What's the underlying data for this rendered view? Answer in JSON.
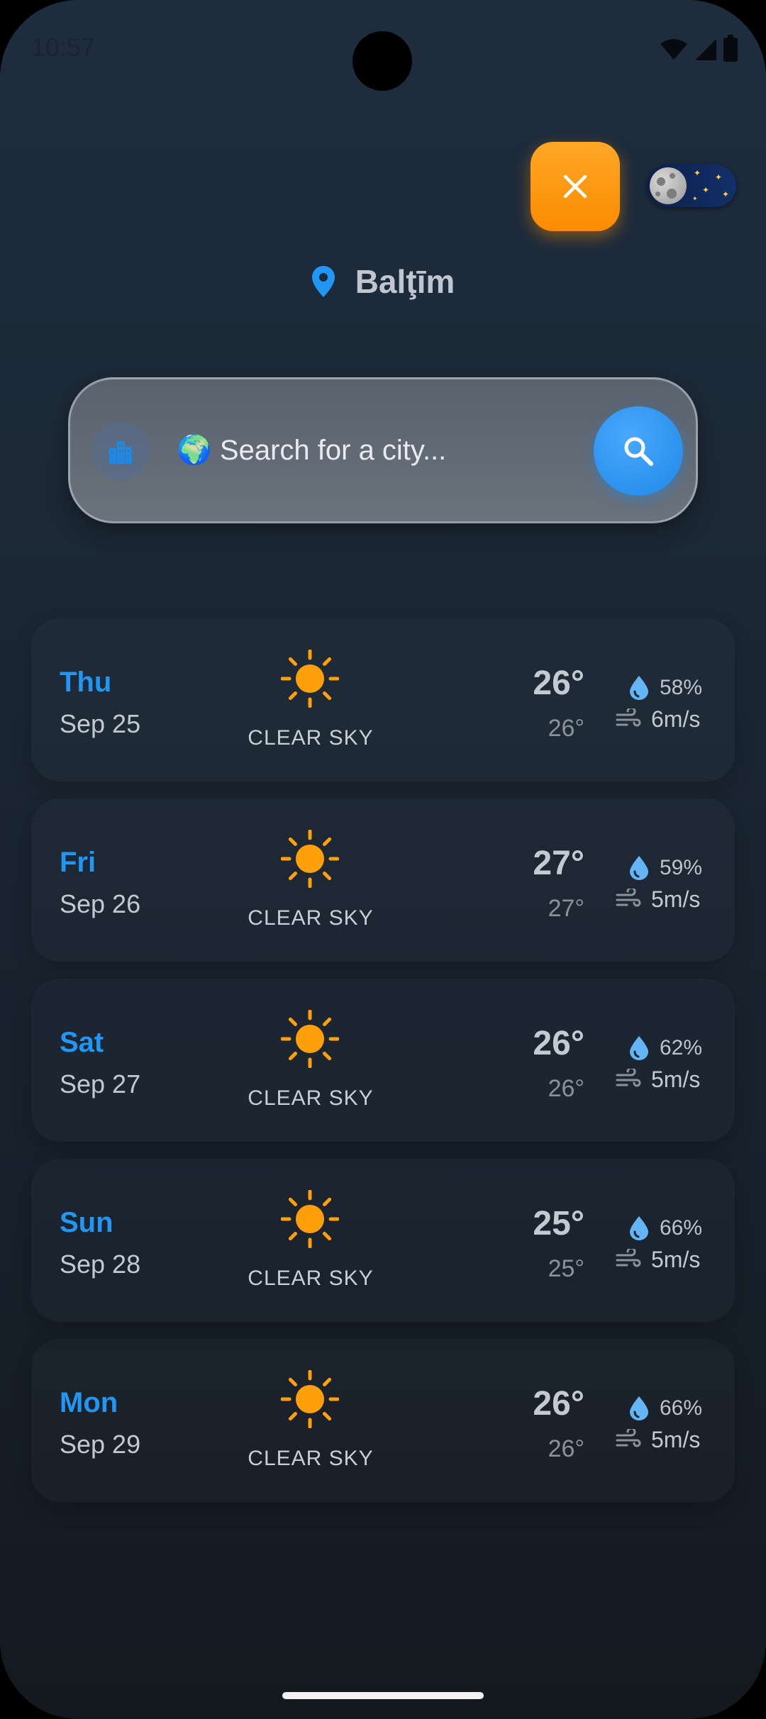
{
  "status_bar": {
    "time": "10:57"
  },
  "header": {
    "location": "Balţīm"
  },
  "search": {
    "placeholder": "🌍 Search for a city..."
  },
  "colors": {
    "accent_blue": "#2196f3",
    "orange": "#fb8c00",
    "sun": "#ff9f0a"
  },
  "forecast": [
    {
      "day": "Thu",
      "date": "Sep 25",
      "icon": "sun-icon",
      "condition": "CLEAR SKY",
      "temp_max": "26°",
      "temp_min": "26°",
      "humidity": "58%",
      "wind": "6m/s"
    },
    {
      "day": "Fri",
      "date": "Sep 26",
      "icon": "sun-icon",
      "condition": "CLEAR SKY",
      "temp_max": "27°",
      "temp_min": "27°",
      "humidity": "59%",
      "wind": "5m/s"
    },
    {
      "day": "Sat",
      "date": "Sep 27",
      "icon": "sun-icon",
      "condition": "CLEAR SKY",
      "temp_max": "26°",
      "temp_min": "26°",
      "humidity": "62%",
      "wind": "5m/s"
    },
    {
      "day": "Sun",
      "date": "Sep 28",
      "icon": "sun-icon",
      "condition": "CLEAR SKY",
      "temp_max": "25°",
      "temp_min": "25°",
      "humidity": "66%",
      "wind": "5m/s"
    },
    {
      "day": "Mon",
      "date": "Sep 29",
      "icon": "sun-icon",
      "condition": "CLEAR SKY",
      "temp_max": "26°",
      "temp_min": "26°",
      "humidity": "66%",
      "wind": "5m/s"
    }
  ]
}
